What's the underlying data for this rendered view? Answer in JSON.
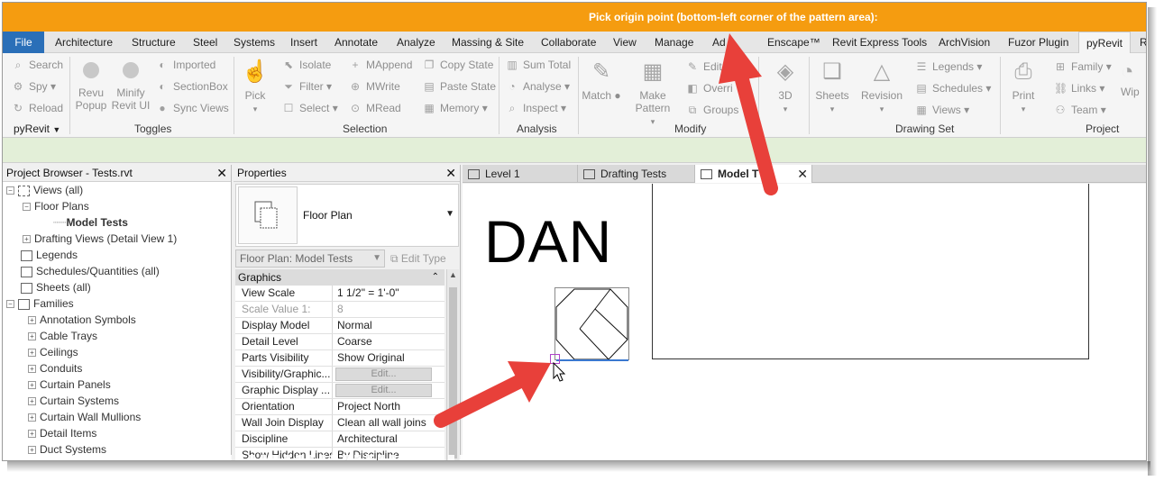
{
  "prompt": "Pick origin point (bottom-left corner of the pattern area):",
  "ribbon_tabs": [
    {
      "label": "File"
    },
    {
      "label": "Architecture"
    },
    {
      "label": "Structure"
    },
    {
      "label": "Steel"
    },
    {
      "label": "Systems"
    },
    {
      "label": "Insert"
    },
    {
      "label": "Annotate"
    },
    {
      "label": "Analyze"
    },
    {
      "label": "Massing & Site"
    },
    {
      "label": "Collaborate"
    },
    {
      "label": "View"
    },
    {
      "label": "Manage"
    },
    {
      "label": "Ad"
    },
    {
      "label": "Enscape™"
    },
    {
      "label": "Revit Express Tools"
    },
    {
      "label": "ArchVision"
    },
    {
      "label": "Fuzor Plugin"
    },
    {
      "label": "pyRevit"
    },
    {
      "label": "R"
    }
  ],
  "ribbon": {
    "pyrevit_panel": {
      "search": "Search",
      "spy": "Spy",
      "reload": "Reload",
      "label": "pyRevit"
    },
    "toggles_panel": {
      "revu_popup": "Revu\nPopup",
      "minify": "Minify\nRevit UI",
      "imported": "Imported",
      "sectionbox": "SectionBox",
      "sync_views": "Sync Views",
      "label": "Toggles"
    },
    "selection_panel": {
      "pick": "Pick",
      "isolate": "Isolate",
      "filter": "Filter",
      "select": "Select",
      "mappend": "MAppend",
      "mwrite": "MWrite",
      "mread": "MRead",
      "copy_state": "Copy State",
      "paste_state": "Paste State",
      "memory": "Memory",
      "label": "Selection"
    },
    "analysis_panel": {
      "sum_total": "Sum Total",
      "analyse": "Analyse",
      "inspect": "Inspect",
      "label": "Analysis"
    },
    "modify_panel": {
      "match": "Match",
      "make_pattern": "Make\nPattern",
      "edit": "Edit",
      "override": "Overri",
      "groups": "Groups",
      "label": "Modify"
    },
    "view_3d": "3D",
    "drawing_set_panel": {
      "sheets": "Sheets",
      "revision": "Revision",
      "legends": "Legends",
      "schedules": "Schedules",
      "views": "Views",
      "label": "Drawing Set"
    },
    "project_panel": {
      "print": "Print",
      "family": "Family",
      "links": "Links",
      "team": "Team",
      "wipe": "Wip",
      "label": "Project"
    }
  },
  "project_browser": {
    "title": "Project Browser - Tests.rvt",
    "items": [
      {
        "label": "Views (all)"
      },
      {
        "label": "Floor Plans"
      },
      {
        "label": "Model Tests"
      },
      {
        "label": "Drafting Views (Detail View 1)"
      },
      {
        "label": "Legends"
      },
      {
        "label": "Schedules/Quantities (all)"
      },
      {
        "label": "Sheets (all)"
      },
      {
        "label": "Families"
      },
      {
        "label": "Annotation Symbols"
      },
      {
        "label": "Cable Trays"
      },
      {
        "label": "Ceilings"
      },
      {
        "label": "Conduits"
      },
      {
        "label": "Curtain Panels"
      },
      {
        "label": "Curtain Systems"
      },
      {
        "label": "Curtain Wall Mullions"
      },
      {
        "label": "Detail Items"
      },
      {
        "label": "Duct Systems"
      }
    ]
  },
  "properties": {
    "title": "Properties",
    "type_name": "Floor Plan",
    "instance_selector": "Floor Plan: Model Tests",
    "edit_type": "Edit Type",
    "group": "Graphics",
    "rows": [
      {
        "name": "View Scale",
        "value": "1 1/2\" = 1'-0\""
      },
      {
        "name": "Scale Value    1:",
        "value": "8"
      },
      {
        "name": "Display Model",
        "value": "Normal"
      },
      {
        "name": "Detail Level",
        "value": "Coarse"
      },
      {
        "name": "Parts Visibility",
        "value": "Show Original"
      },
      {
        "name": "Visibility/Graphic...",
        "value": "Edit..."
      },
      {
        "name": "Graphic Display ...",
        "value": "Edit..."
      },
      {
        "name": "Orientation",
        "value": "Project North"
      },
      {
        "name": "Wall Join Display",
        "value": "Clean all wall joins"
      },
      {
        "name": "Discipline",
        "value": "Architectural"
      },
      {
        "name": "Show Hidden Lines",
        "value": "By Discipline"
      }
    ]
  },
  "view_tabs": [
    {
      "label": "Level 1"
    },
    {
      "label": "Drafting Tests"
    },
    {
      "label": "Model T"
    }
  ],
  "canvas": {
    "text": "DAN"
  },
  "colors": {
    "prompt_bar": "#f59c10",
    "file_tab": "#2a6fb8",
    "options_bar": "#e3efd8",
    "annotation_arrow": "#e8403a",
    "pick_marker": "#b044c8",
    "baseline": "#3a78d0"
  }
}
